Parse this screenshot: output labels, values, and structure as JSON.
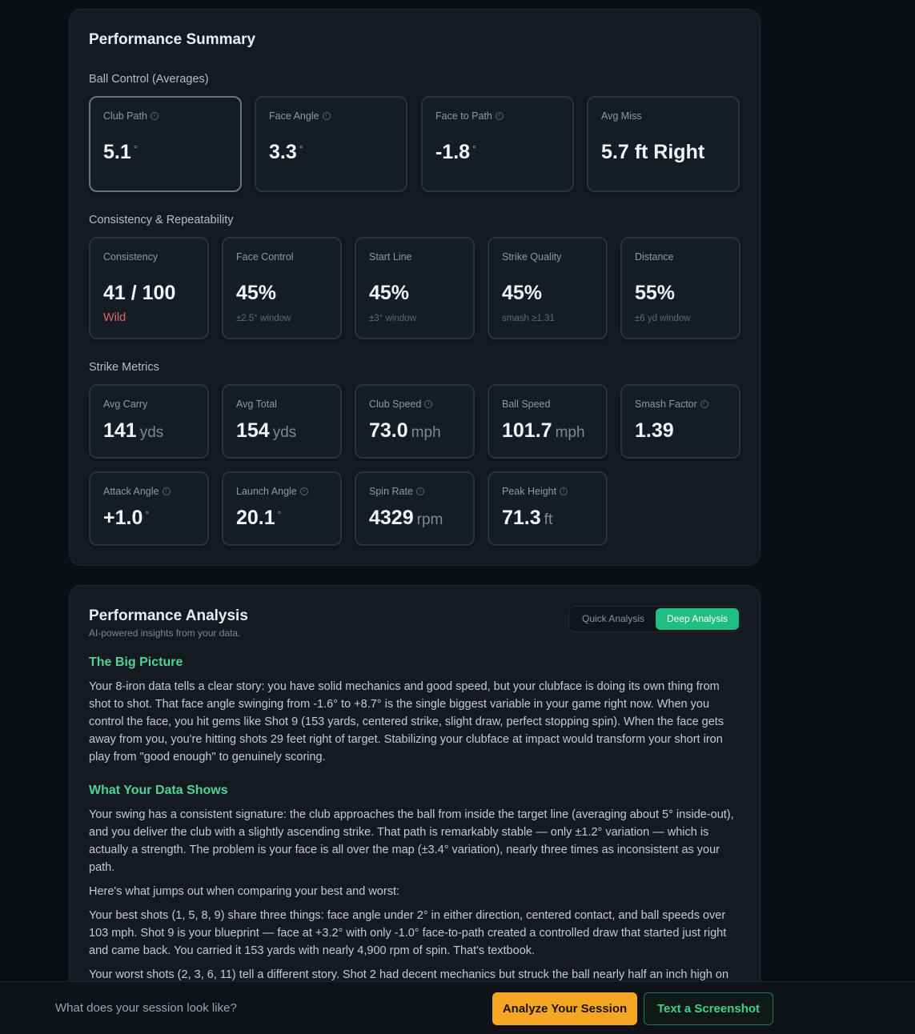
{
  "summary": {
    "title": "Performance Summary",
    "ball_control": {
      "label": "Ball Control (Averages)",
      "cards": [
        {
          "label": "Club Path",
          "value": "5.1",
          "unit": "°",
          "info": true,
          "selected": true
        },
        {
          "label": "Face Angle",
          "value": "3.3",
          "unit": "°",
          "info": true
        },
        {
          "label": "Face to Path",
          "value": "-1.8",
          "unit": "°",
          "info": true
        },
        {
          "label": "Avg Miss",
          "value": "5.7 ft Right"
        }
      ]
    },
    "consistency": {
      "label": "Consistency & Repeatability",
      "cards": [
        {
          "label": "Consistency",
          "value": "41 / 100",
          "sub": "Wild"
        },
        {
          "label": "Face Control",
          "value": "45%",
          "sub": "±2.5° window"
        },
        {
          "label": "Start Line",
          "value": "45%",
          "sub": "±3° window"
        },
        {
          "label": "Strike Quality",
          "value": "45%",
          "sub": "smash ≥1.31"
        },
        {
          "label": "Distance",
          "value": "55%",
          "sub": "±6 yd window"
        }
      ]
    },
    "strike": {
      "label": "Strike Metrics",
      "cards": [
        {
          "label": "Avg Carry",
          "value": "141",
          "unit": "yds"
        },
        {
          "label": "Avg Total",
          "value": "154",
          "unit": "yds"
        },
        {
          "label": "Club Speed",
          "value": "73.0",
          "unit": "mph",
          "info": true
        },
        {
          "label": "Ball Speed",
          "value": "101.7",
          "unit": "mph"
        },
        {
          "label": "Smash Factor",
          "value": "1.39",
          "info": true
        },
        {
          "label": "Attack Angle",
          "value": "+1.0",
          "unit": "°",
          "info": true
        },
        {
          "label": "Launch Angle",
          "value": "20.1",
          "unit": "°",
          "info": true
        },
        {
          "label": "Spin Rate",
          "value": "4329",
          "unit": "rpm",
          "info": true
        },
        {
          "label": "Peak Height",
          "value": "71.3",
          "unit": "ft",
          "info": true
        }
      ]
    }
  },
  "analysis": {
    "title": "Performance Analysis",
    "subtitle": "AI-powered insights from your data.",
    "toggle": {
      "quick": "Quick Analysis",
      "deep": "Deep Analysis",
      "active": "deep"
    },
    "big_picture": {
      "heading": "The Big Picture",
      "text": "Your 8-iron data tells a clear story: you have solid mechanics and good speed, but your clubface is doing its own thing from shot to shot. That face angle swinging from -1.6° to +8.7° is the single biggest variable in your game right now. When you control the face, you hit gems like Shot 9 (153 yards, centered strike, slight draw, perfect stopping spin). When the face gets away from you, you're hitting shots 29 feet right of target. Stabilizing your clubface at impact would transform your short iron play from \"good enough\" to genuinely scoring."
    },
    "data_shows": {
      "heading": "What Your Data Shows",
      "p1": "Your swing has a consistent signature: the club approaches the ball from inside the target line (averaging about 5° inside-out), and you deliver the club with a slightly ascending strike. That path is remarkably stable — only ±1.2° variation — which is actually a strength. The problem is your face is all over the map (±3.4° variation), nearly three times as inconsistent as your path.",
      "p2": "Here's what jumps out when comparing your best and worst:",
      "p3": "Your best shots (1, 5, 8, 9) share three things: face angle under 2° in either direction, centered contact, and ball speeds over 103 mph. Shot 9 is your blueprint — face at +3.2° with only -1.0° face-to-path created a controlled draw that started just right and came back. You carried it 153 yards with nearly 4,900 rpm of spin. That's textbook.",
      "p4": "Your worst shots (2, 3, 6, 11) tell a different story. Shot 2 had decent mechanics but struck the ball nearly half an inch high on"
    }
  },
  "bottom_bar": {
    "prompt": "What does your session look like?",
    "primary": "Analyze Your Session",
    "secondary": "Text a Screenshot"
  },
  "colors": {
    "accent_green": "#1fbf84",
    "heading_green": "#4fd39b",
    "cta_orange": "#f5a623",
    "warning_red": "#e0676a"
  }
}
